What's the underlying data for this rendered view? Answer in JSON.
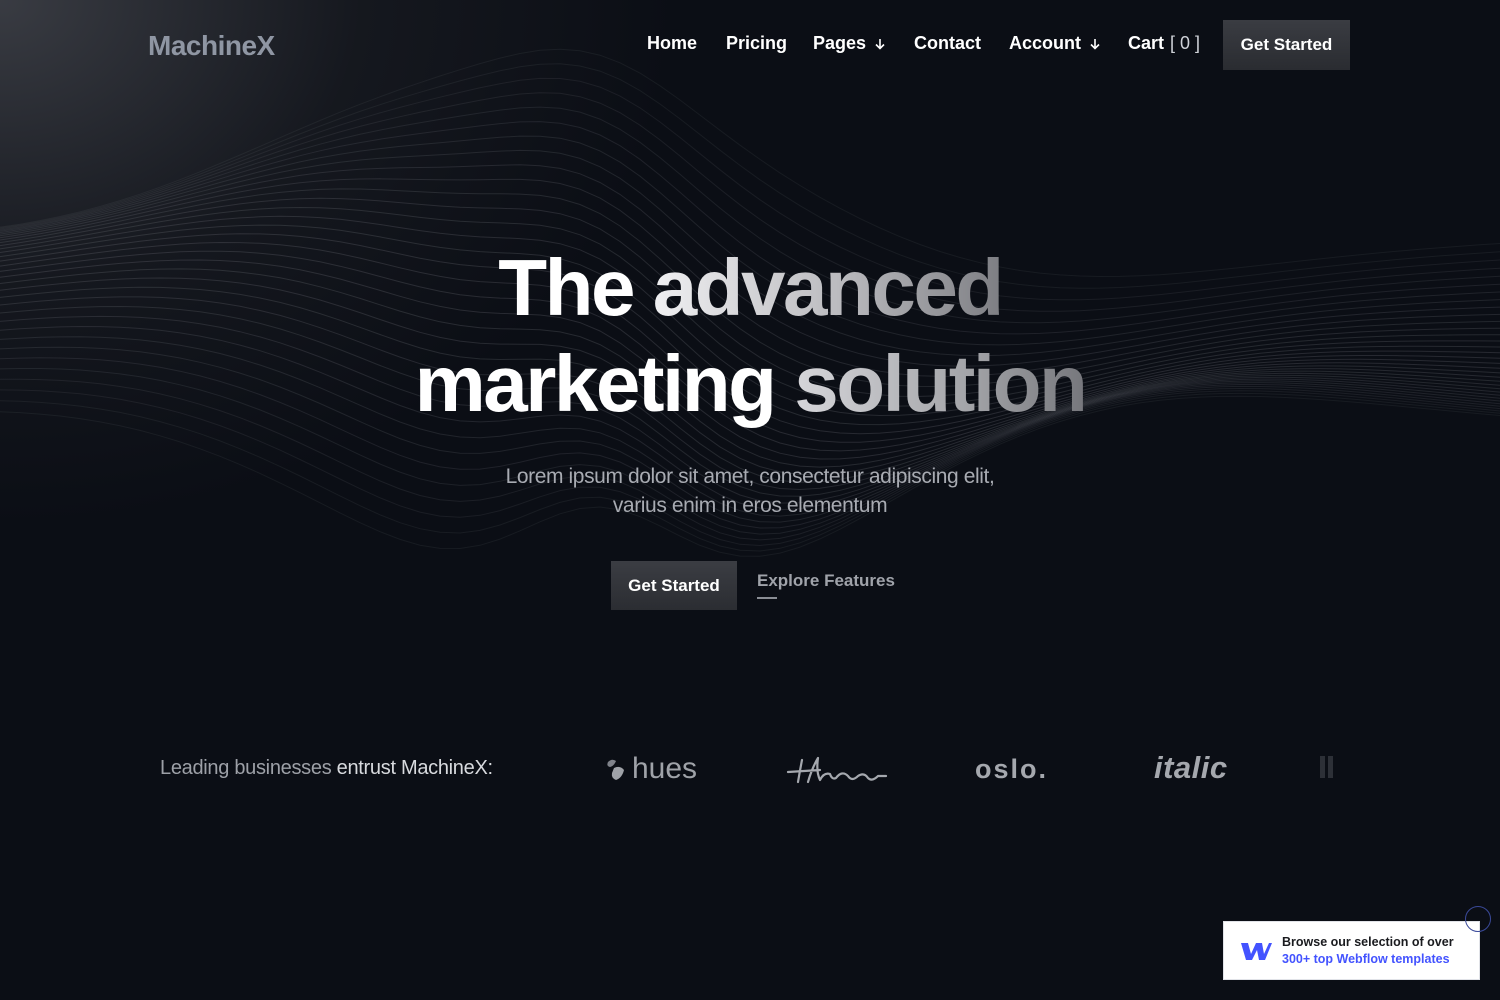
{
  "brand": {
    "logo": "MachineX"
  },
  "nav": {
    "items": [
      {
        "label": "Home"
      },
      {
        "label": "Pricing"
      },
      {
        "label": "Pages",
        "has_dropdown": true
      },
      {
        "label": "Contact"
      },
      {
        "label": "Account",
        "has_dropdown": true
      }
    ],
    "cart": {
      "label": "Cart",
      "count": "[ 0 ]"
    },
    "cta": "Get Started"
  },
  "hero": {
    "title_line1_a": "The ",
    "title_line1_b": "advanced",
    "title_line2_a": "marketing ",
    "title_line2_b": "solution",
    "subtitle_line1": "Lorem ipsum dolor sit amet, consectetur adipiscing elit,",
    "subtitle_line2": "varius enim in eros elementum",
    "primary_cta": "Get Started",
    "secondary_cta": "Explore Features"
  },
  "trust": {
    "label_a": "Leading businesses ",
    "label_b": "entrust MachineX:",
    "logos": [
      "hues",
      "theo",
      "oslo.",
      "italic"
    ]
  },
  "badge": {
    "line1": "Browse our selection of over",
    "line2": "300+ top Webflow templates"
  },
  "colors": {
    "background": "#0b0e15",
    "button": "#2f3136",
    "webflow_blue": "#4353ff"
  },
  "icons": [
    "chevron-down-icon",
    "webflow-icon",
    "hues-logo-icon"
  ]
}
